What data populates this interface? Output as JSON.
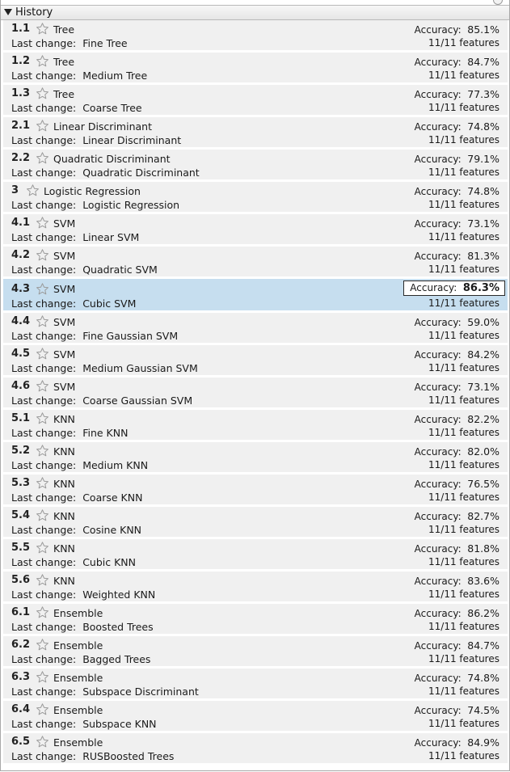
{
  "panel": {
    "title": "History",
    "last_change_label": "Last change:",
    "accuracy_label": "Accuracy:",
    "selected_index": 8,
    "colors": {
      "row_bg": "#f0f0f0",
      "selected_bg": "#c6deef",
      "star_outline": "#9a9a9a"
    }
  },
  "models": [
    {
      "num": "1.1",
      "type": "Tree",
      "change": "Fine Tree",
      "accuracy": "85.1%",
      "features": "11/11 features"
    },
    {
      "num": "1.2",
      "type": "Tree",
      "change": "Medium Tree",
      "accuracy": "84.7%",
      "features": "11/11 features"
    },
    {
      "num": "1.3",
      "type": "Tree",
      "change": "Coarse Tree",
      "accuracy": "77.3%",
      "features": "11/11 features"
    },
    {
      "num": "2.1",
      "type": "Linear Discriminant",
      "change": "Linear Discriminant",
      "accuracy": "74.8%",
      "features": "11/11 features"
    },
    {
      "num": "2.2",
      "type": "Quadratic Discriminant",
      "change": "Quadratic Discriminant",
      "accuracy": "79.1%",
      "features": "11/11 features"
    },
    {
      "num": "3",
      "type": "Logistic Regression",
      "change": "Logistic Regression",
      "accuracy": "74.8%",
      "features": "11/11 features"
    },
    {
      "num": "4.1",
      "type": "SVM",
      "change": "Linear SVM",
      "accuracy": "73.1%",
      "features": "11/11 features"
    },
    {
      "num": "4.2",
      "type": "SVM",
      "change": "Quadratic SVM",
      "accuracy": "81.3%",
      "features": "11/11 features"
    },
    {
      "num": "4.3",
      "type": "SVM",
      "change": "Cubic SVM",
      "accuracy": "86.3%",
      "features": "11/11 features"
    },
    {
      "num": "4.4",
      "type": "SVM",
      "change": "Fine Gaussian SVM",
      "accuracy": "59.0%",
      "features": "11/11 features"
    },
    {
      "num": "4.5",
      "type": "SVM",
      "change": "Medium Gaussian SVM",
      "accuracy": "84.2%",
      "features": "11/11 features"
    },
    {
      "num": "4.6",
      "type": "SVM",
      "change": "Coarse Gaussian SVM",
      "accuracy": "73.1%",
      "features": "11/11 features"
    },
    {
      "num": "5.1",
      "type": "KNN",
      "change": "Fine KNN",
      "accuracy": "82.2%",
      "features": "11/11 features"
    },
    {
      "num": "5.2",
      "type": "KNN",
      "change": "Medium KNN",
      "accuracy": "82.0%",
      "features": "11/11 features"
    },
    {
      "num": "5.3",
      "type": "KNN",
      "change": "Coarse KNN",
      "accuracy": "76.5%",
      "features": "11/11 features"
    },
    {
      "num": "5.4",
      "type": "KNN",
      "change": "Cosine KNN",
      "accuracy": "82.7%",
      "features": "11/11 features"
    },
    {
      "num": "5.5",
      "type": "KNN",
      "change": "Cubic KNN",
      "accuracy": "81.8%",
      "features": "11/11 features"
    },
    {
      "num": "5.6",
      "type": "KNN",
      "change": "Weighted KNN",
      "accuracy": "83.6%",
      "features": "11/11 features"
    },
    {
      "num": "6.1",
      "type": "Ensemble",
      "change": "Boosted Trees",
      "accuracy": "86.2%",
      "features": "11/11 features"
    },
    {
      "num": "6.2",
      "type": "Ensemble",
      "change": "Bagged Trees",
      "accuracy": "84.7%",
      "features": "11/11 features"
    },
    {
      "num": "6.3",
      "type": "Ensemble",
      "change": "Subspace Discriminant",
      "accuracy": "74.8%",
      "features": "11/11 features"
    },
    {
      "num": "6.4",
      "type": "Ensemble",
      "change": "Subspace KNN",
      "accuracy": "74.5%",
      "features": "11/11 features"
    },
    {
      "num": "6.5",
      "type": "Ensemble",
      "change": "RUSBoosted Trees",
      "accuracy": "84.9%",
      "features": "11/11 features"
    }
  ]
}
